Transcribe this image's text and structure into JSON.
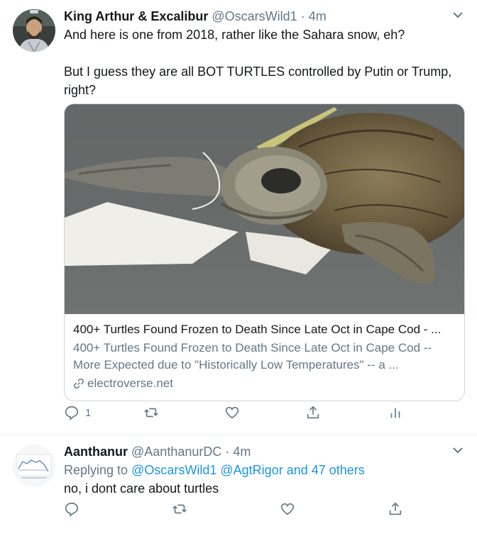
{
  "tweet1": {
    "name": "King Arthur & Excalibur",
    "handle": "@OscarsWild1",
    "sep": "·",
    "time": "4m",
    "text_line1": "And here is one from 2018, rather like the Sahara snow, eh?",
    "text_line2": "But I guess they are all BOT TURTLES controlled by Putin or Trump, right?",
    "card": {
      "title": "400+ Turtles Found Frozen to Death Since Late Oct in Cape Cod - ...",
      "description": "400+ Turtles Found Frozen to Death Since Late Oct in Cape Cod -- More Expected due to \"Historically Low Temperatures\" -- a ...",
      "domain": "electroverse.net"
    },
    "reply_count": "1",
    "retweet_count": "",
    "like_count": ""
  },
  "tweet2": {
    "name": "Aanthanur",
    "handle": "@AanthanurDC",
    "sep": "·",
    "time": "4m",
    "replying_prefix": "Replying to",
    "replying_to_1": "@OscarsWild1",
    "replying_to_2": "@AgtRigor",
    "replying_and_others": "and 47 others",
    "text": "no, i dont care about turtles"
  },
  "colors": {
    "accent": "#1b95e0",
    "muted": "#657786",
    "border": "#e6ecf0"
  }
}
